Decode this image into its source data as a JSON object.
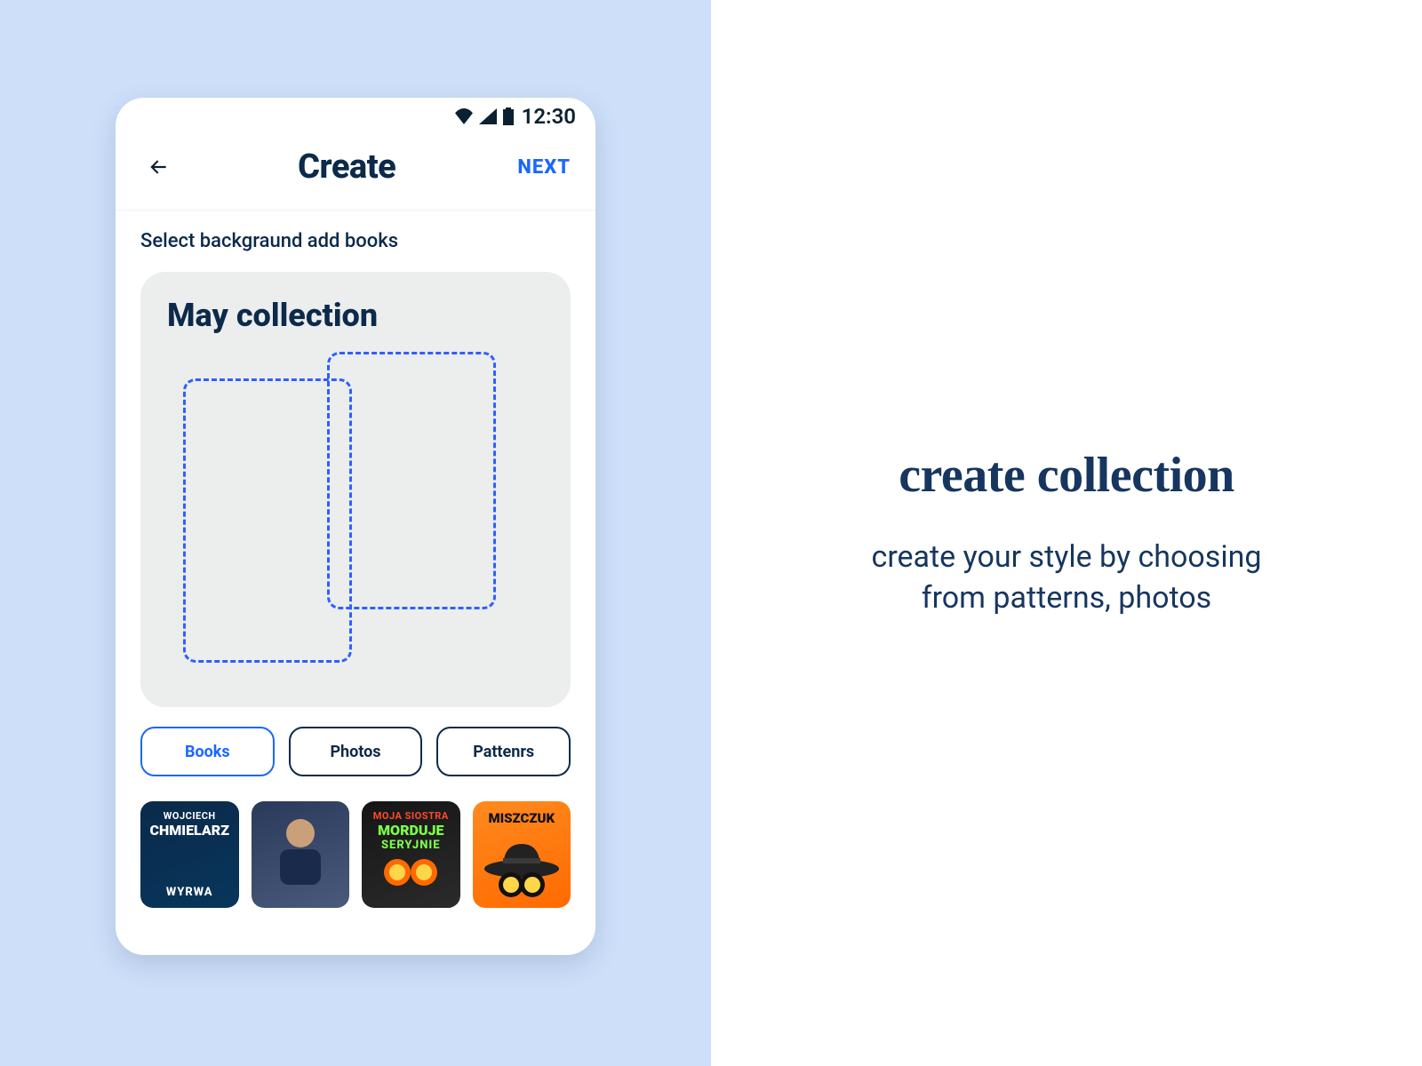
{
  "status": {
    "time": "12:30"
  },
  "header": {
    "title": "Create",
    "next": "NEXT"
  },
  "instruction": "Select backgraund add books",
  "canvas": {
    "title": "May collection"
  },
  "tabs": [
    {
      "label": "Books",
      "active": true
    },
    {
      "label": "Photos",
      "active": false
    },
    {
      "label": "Pattenrs",
      "active": false
    }
  ],
  "books": [
    {
      "line1": "WOJCIECH",
      "line2": "CHMIELARZ",
      "line3": "WYRWA"
    },
    {
      "line1": "",
      "line2": "",
      "line3": ""
    },
    {
      "line1": "MOJA SIOSTRA",
      "line2": "MORDUJE",
      "line3": "SERYJNIE"
    },
    {
      "line1": "",
      "line2": "MISZCZUK",
      "line3": ""
    }
  ],
  "marketing": {
    "headline": "create collection",
    "sub": "create your style by choosing from patterns, photos"
  }
}
